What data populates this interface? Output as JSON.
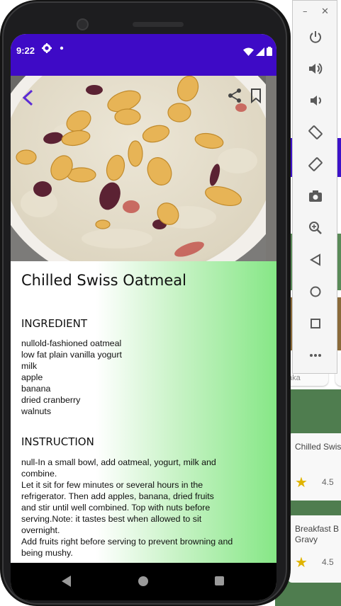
{
  "status_bar": {
    "time": "9:22",
    "bg_color": "#3e0ac6",
    "icons": [
      "gear-icon",
      "notification-dot-icon",
      "wifi-icon",
      "signal-icon",
      "battery-icon"
    ]
  },
  "hero": {
    "image": "oatmeal-with-peanuts-and-cranberries",
    "actions": [
      "back-arrow-icon",
      "share-icon",
      "bookmark-icon"
    ],
    "accent_color": "#5b2bd6"
  },
  "recipe": {
    "title": "Chilled Swiss Oatmeal",
    "ingredient_heading": "INGREDIENT",
    "ingredients": [
      "nullold-fashioned oatmeal",
      "low fat plain vanilla yogurt",
      "milk",
      "apple",
      "banana",
      "dried cranberry",
      "walnuts"
    ],
    "instruction_heading": "INSTRUCTION",
    "instructions": "null-In a small bowl, add oatmeal, yogurt, milk and\ncombine.\nLet it sit for few minutes or several hours in the\nrefrigerator.  Then add apples, banana, dried fruits\nand stir until well combined. Top with nuts before\nserving.Note: it tastes best when allowed to sit\novernight.\nAdd fruits right before serving to prevent browning and\nbeing mushy."
  },
  "background_app": {
    "card_partial_text": "aka",
    "cards": [
      {
        "title": "Chilled Swis",
        "rating": "4.5"
      },
      {
        "title": "Breakfast B\nGravy",
        "rating": "4.5"
      }
    ]
  },
  "emulator_toolbar": {
    "window_controls": [
      "minimize-icon",
      "close-icon"
    ],
    "buttons": [
      "power-icon",
      "volume-up-icon",
      "volume-down-icon",
      "rotate-left-icon",
      "rotate-right-icon",
      "camera-icon",
      "zoom-icon",
      "back-icon",
      "home-icon",
      "overview-icon",
      "more-icon"
    ]
  },
  "nav_bar": {
    "buttons": [
      "nav-back-icon",
      "nav-home-icon",
      "nav-recents-icon"
    ]
  }
}
